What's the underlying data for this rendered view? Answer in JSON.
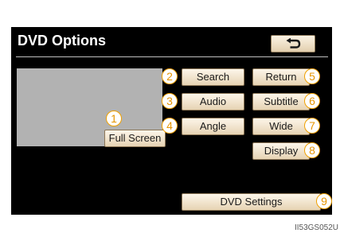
{
  "screen": {
    "title": "DVD Options"
  },
  "icons": {
    "back": "return-arrow-icon"
  },
  "colors": {
    "screen_background": "#000000",
    "button_fill": "#f2e4cb",
    "button_border": "#8d7757",
    "callout_orange": "#f0a000",
    "preview_gray": "#b2b2b2"
  },
  "buttons": {
    "full_screen": "Full Screen",
    "search": "Search",
    "audio": "Audio",
    "angle": "Angle",
    "return": "Return",
    "subtitle": "Subtitle",
    "wide": "Wide",
    "display": "Display",
    "dvd_settings": "DVD Settings"
  },
  "callouts": {
    "full_screen": "1",
    "search": "2",
    "audio": "3",
    "angle": "4",
    "return": "5",
    "subtitle": "6",
    "wide": "7",
    "display": "8",
    "dvd_settings": "9"
  },
  "image_code": "II53GS052U"
}
